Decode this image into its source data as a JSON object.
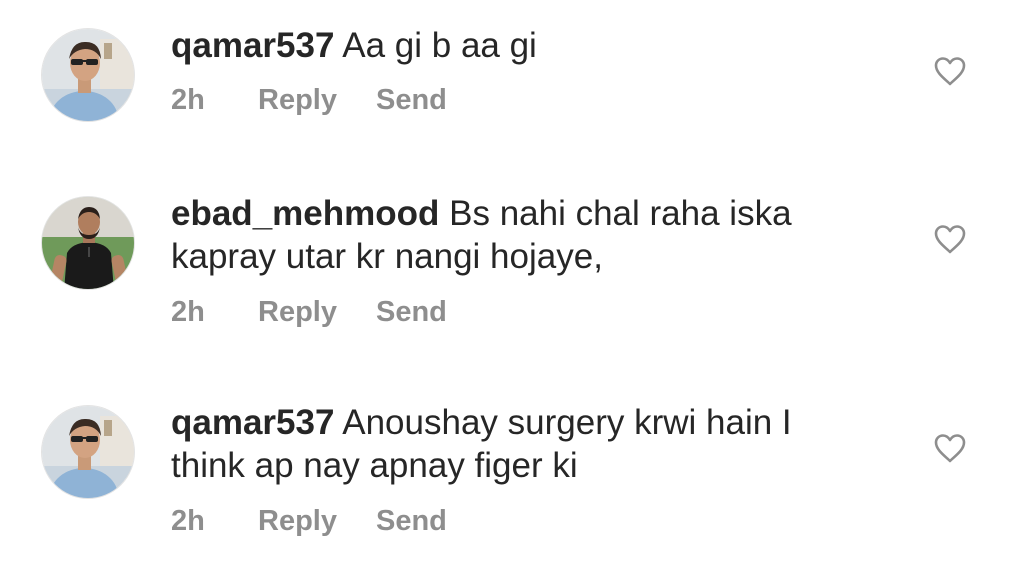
{
  "comments": [
    {
      "username": "qamar537",
      "text": "Aa gi b aa gi",
      "time": "2h",
      "reply_label": "Reply",
      "send_label": "Send",
      "avatar": "avatar-man-sunglasses",
      "like_icon": "heart-outline-icon"
    },
    {
      "username": "ebad_mehmood",
      "text": "Bs nahi chal raha iska kapray utar kr nangi hojaye,",
      "time": "2h",
      "reply_label": "Reply",
      "send_label": "Send",
      "avatar": "avatar-man-black-shirt",
      "like_icon": "heart-outline-icon"
    },
    {
      "username": "qamar537",
      "text": "Anoushay surgery krwi hain I think ap nay apnay figer ki",
      "time": "2h",
      "reply_label": "Reply",
      "send_label": "Send",
      "avatar": "avatar-man-sunglasses",
      "like_icon": "heart-outline-icon"
    }
  ],
  "colors": {
    "text": "#262626",
    "meta": "#8e8e8e",
    "background": "#ffffff"
  }
}
